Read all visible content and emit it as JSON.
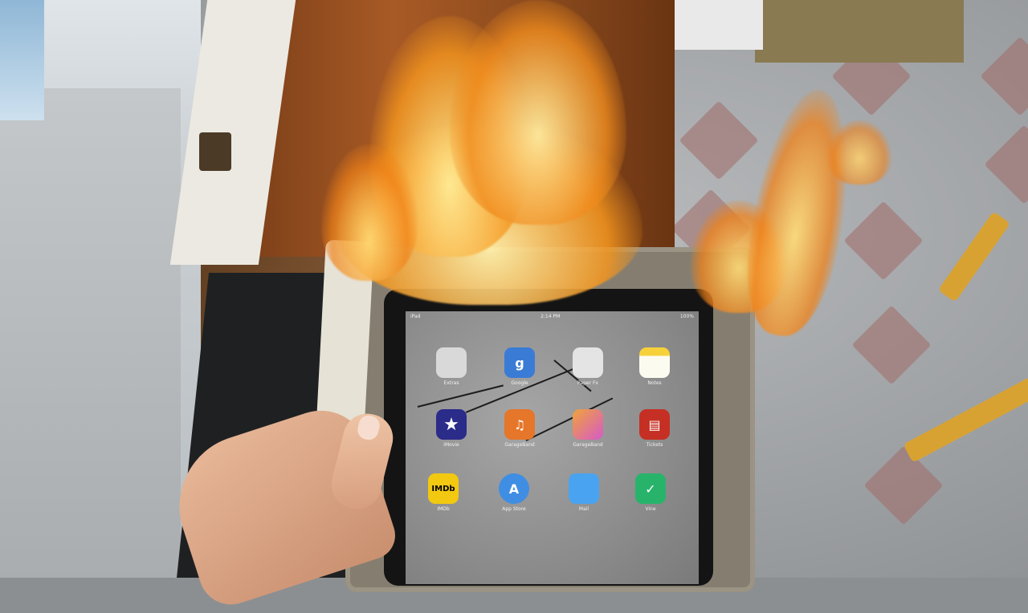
{
  "scene": {
    "subject": "",
    "colors": {
      "flame_core": "#ffe28a",
      "flame_outer": "#f08a1c",
      "case": "#857e70",
      "floor_tile": "#a06c67"
    }
  },
  "tablet": {
    "status": {
      "left": "iPad",
      "center": "2:14 PM",
      "right": "100%"
    },
    "apps": [
      {
        "label": "Extras",
        "icon": "folder-icon",
        "glyph": "",
        "color": "#d9d9d9"
      },
      {
        "label": "Google",
        "icon": "google-icon",
        "glyph": "g",
        "color": "#3a7bd5"
      },
      {
        "label": "Paper Fx",
        "icon": "paper-icon",
        "glyph": "",
        "color": "#e4e4e4"
      },
      {
        "label": "Notes",
        "icon": "notes-icon",
        "glyph": "",
        "color": "#f7d13a"
      },
      {
        "label": "iMovie",
        "icon": "star-icon",
        "glyph": "★",
        "color": "#2b2b8a"
      },
      {
        "label": "GarageBand",
        "icon": "guitar-icon",
        "glyph": "♫",
        "color": "#e5762a"
      },
      {
        "label": "GarageBand",
        "icon": "photo-icon",
        "glyph": "",
        "color": "#d65ac7"
      },
      {
        "label": "Tickets",
        "icon": "ticket-icon",
        "glyph": "▤",
        "color": "#c62f23"
      },
      {
        "label": "IMDb",
        "icon": "imdb-icon",
        "glyph": "IMDb",
        "color": "#f2c811"
      },
      {
        "label": "App Store",
        "icon": "appstore-icon",
        "glyph": "A",
        "color": "#3f8ee3"
      },
      {
        "label": "Mail",
        "icon": "mail-icon",
        "glyph": "",
        "color": "#4aa3f0"
      },
      {
        "label": "Vine",
        "icon": "vine-icon",
        "glyph": "✓",
        "color": "#28b36b"
      }
    ]
  }
}
